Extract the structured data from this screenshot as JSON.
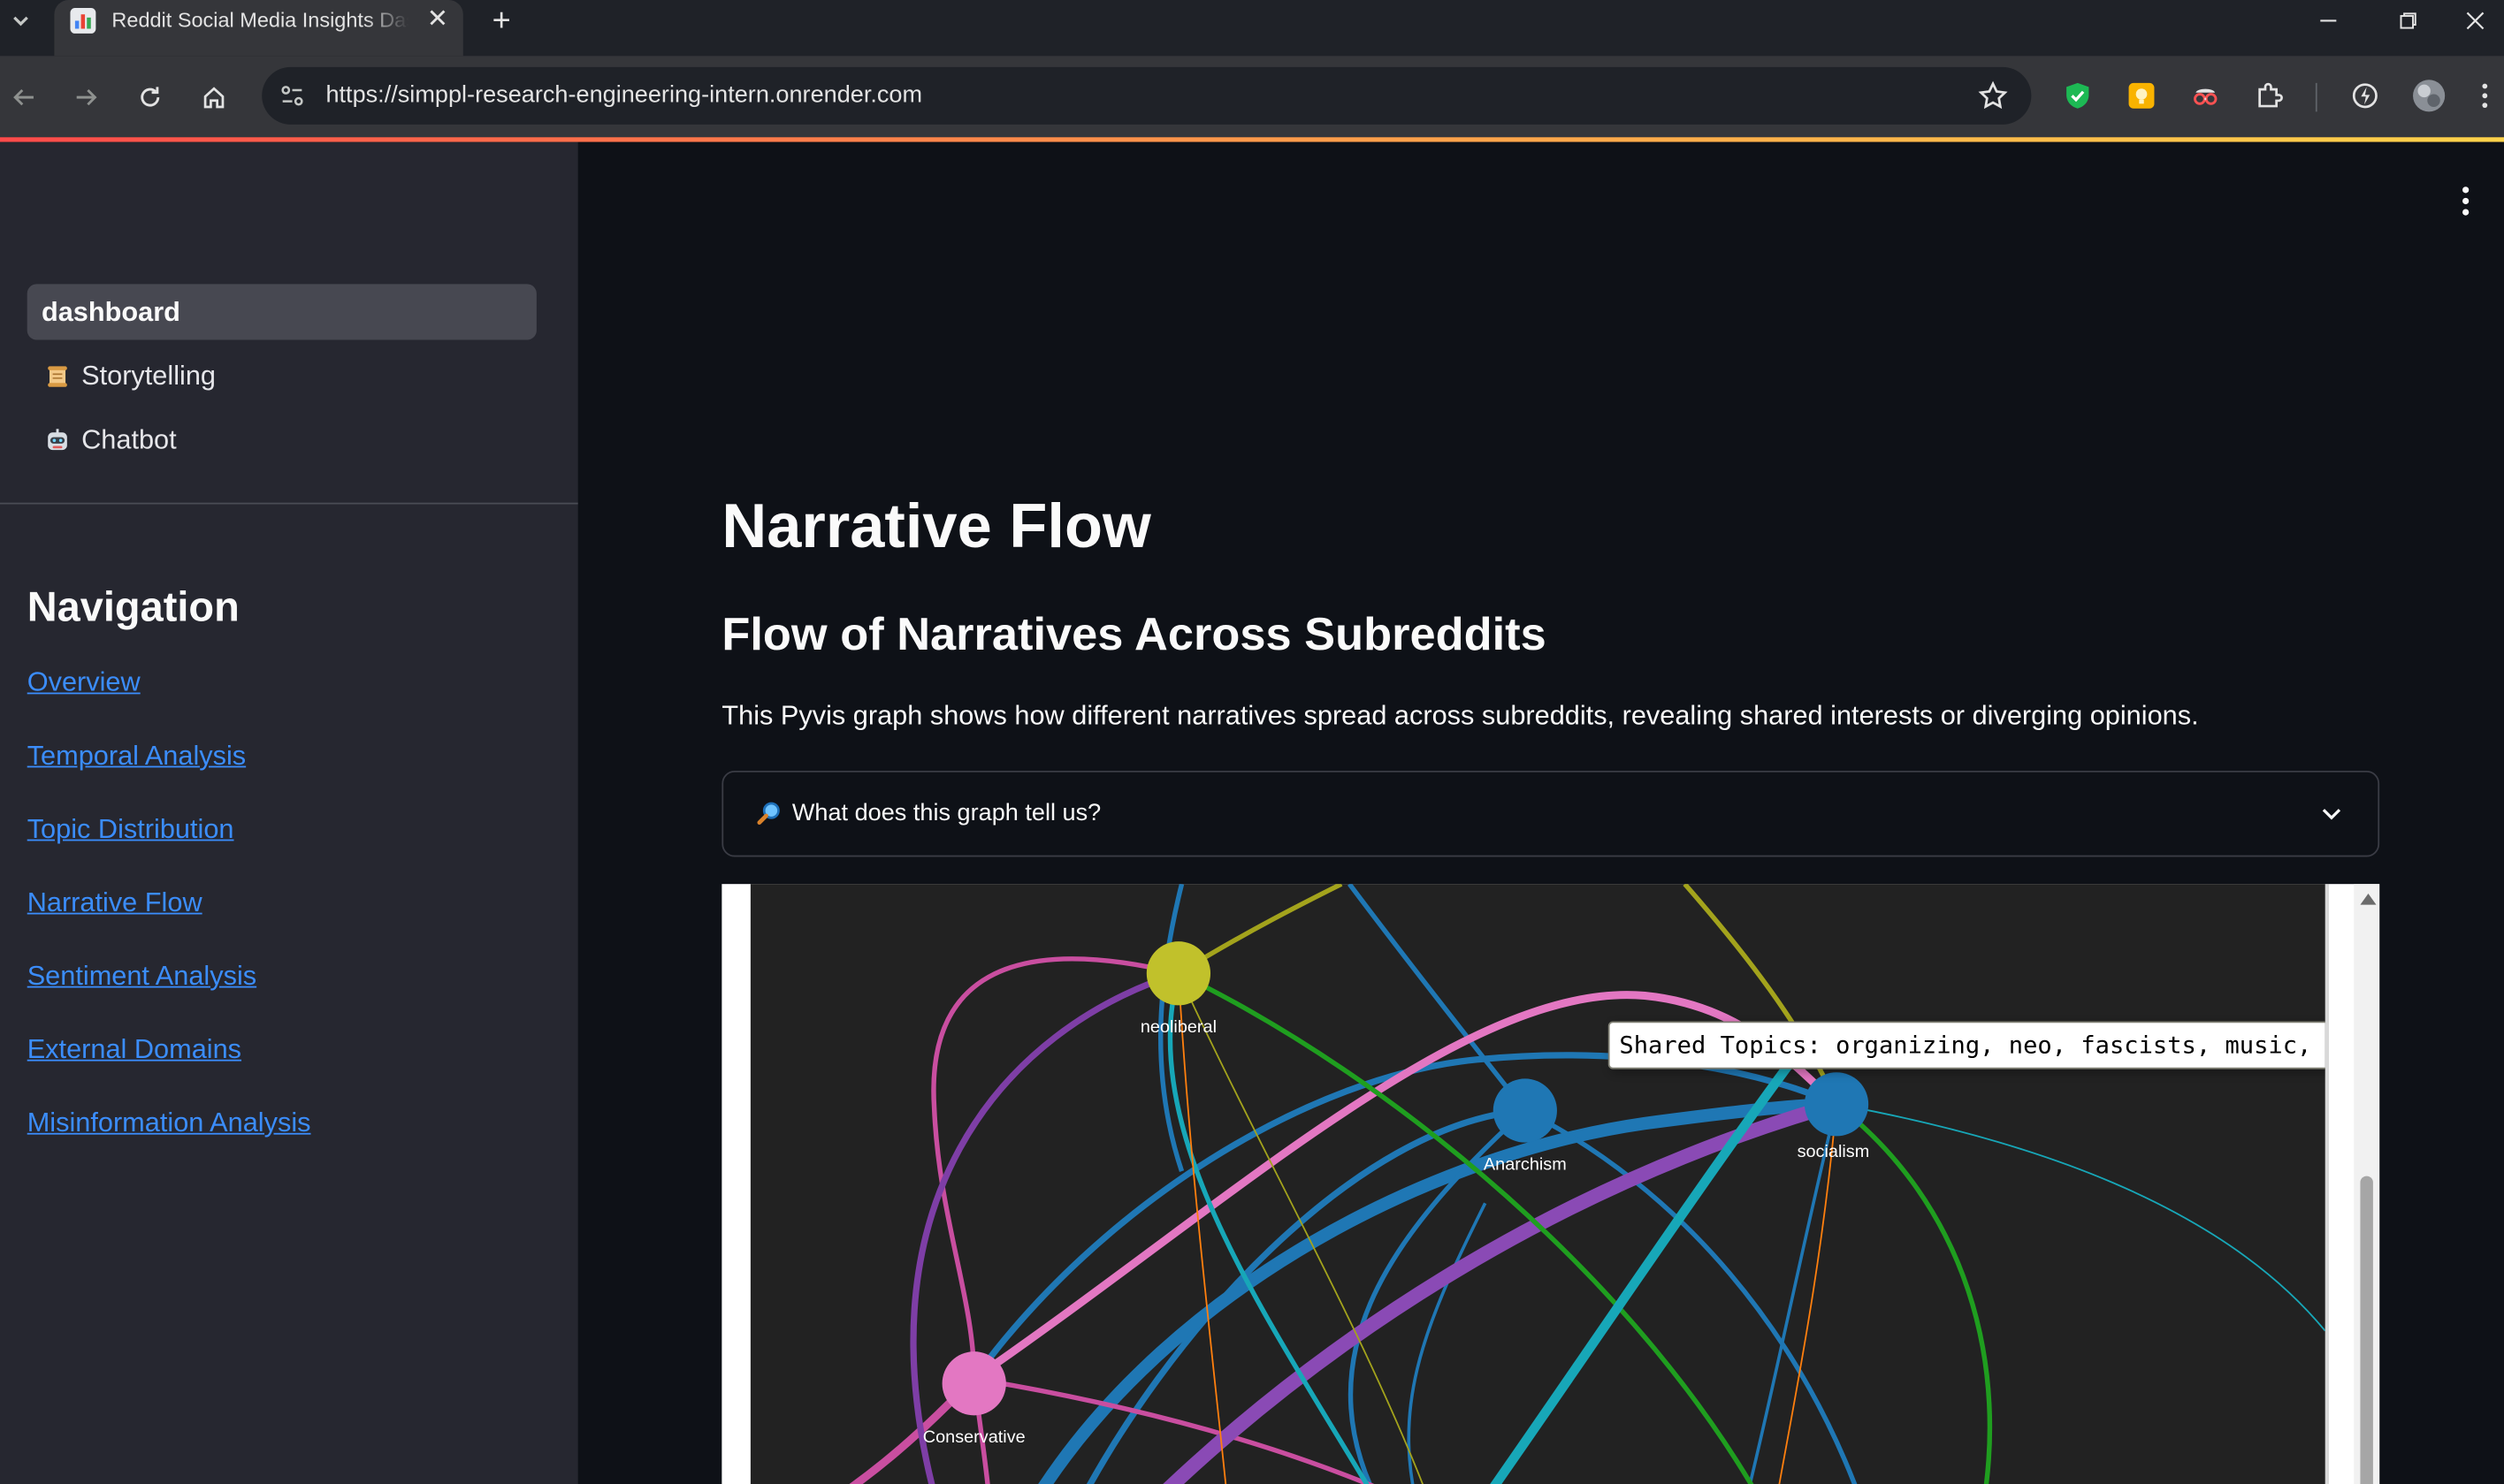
{
  "browser": {
    "tab_title": "Reddit Social Media Insights Dashboard",
    "url": "https://simppl-research-engineering-intern.onrender.com"
  },
  "sidebar": {
    "pages": [
      {
        "label": "dashboard",
        "icon": "",
        "active": true
      },
      {
        "label": "Storytelling",
        "icon": "scroll-icon",
        "active": false
      },
      {
        "label": "Chatbot",
        "icon": "robot-icon",
        "active": false
      }
    ],
    "nav_heading": "Navigation",
    "nav_links": [
      "Overview",
      "Temporal Analysis",
      "Topic Distribution",
      "Narrative Flow",
      "Sentiment Analysis",
      "External Domains",
      "Misinformation Analysis"
    ]
  },
  "main": {
    "title": "Narrative Flow",
    "subtitle": "Flow of Narratives Across Subreddits",
    "description": "This Pyvis graph shows how different narratives spread across subreddits, revealing shared interests or diverging opinions.",
    "expander_label": "What does this graph tell us?",
    "expander_icon": "magnifier-icon"
  },
  "graph": {
    "nodes": [
      {
        "id": "neoliberal",
        "label": "neoliberal",
        "color": "#c1c12b"
      },
      {
        "id": "anarchism",
        "label": "Anarchism",
        "color": "#1f77b4"
      },
      {
        "id": "socialism",
        "label": "socialism",
        "color": "#1f77b4"
      },
      {
        "id": "conservative",
        "label": "Conservative",
        "color": "#e377c2"
      }
    ],
    "tooltip": "Shared Topics: organizing, neo, fascists, music, terrifying"
  },
  "colors": {
    "accent_link": "#3b8dfc",
    "sidebar_bg": "#262730",
    "main_bg": "#0e1117",
    "graph_bg": "#222222"
  }
}
